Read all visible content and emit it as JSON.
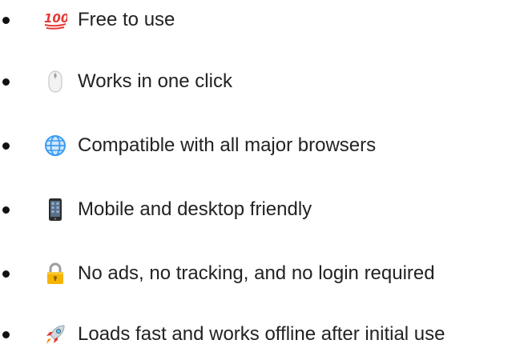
{
  "features": [
    {
      "icon": "hundred-points-icon",
      "label": "Free to use"
    },
    {
      "icon": "computer-mouse-icon",
      "label": "Works in one click"
    },
    {
      "icon": "globe-icon",
      "label": "Compatible with all major browsers"
    },
    {
      "icon": "mobile-phone-icon",
      "label": "Mobile and desktop friendly"
    },
    {
      "icon": "lock-icon",
      "label": "No ads, no tracking, and no login required"
    },
    {
      "icon": "rocket-icon",
      "label": "Loads fast and works offline after initial use"
    }
  ],
  "colors": {
    "text": "#222222",
    "bullet": "#111111",
    "hundred_points": "#e53935",
    "globe": "#3b9bf2",
    "lock": "#f4b400",
    "phone": "#2b2b2b",
    "rocket_flame": "#f57c00"
  }
}
